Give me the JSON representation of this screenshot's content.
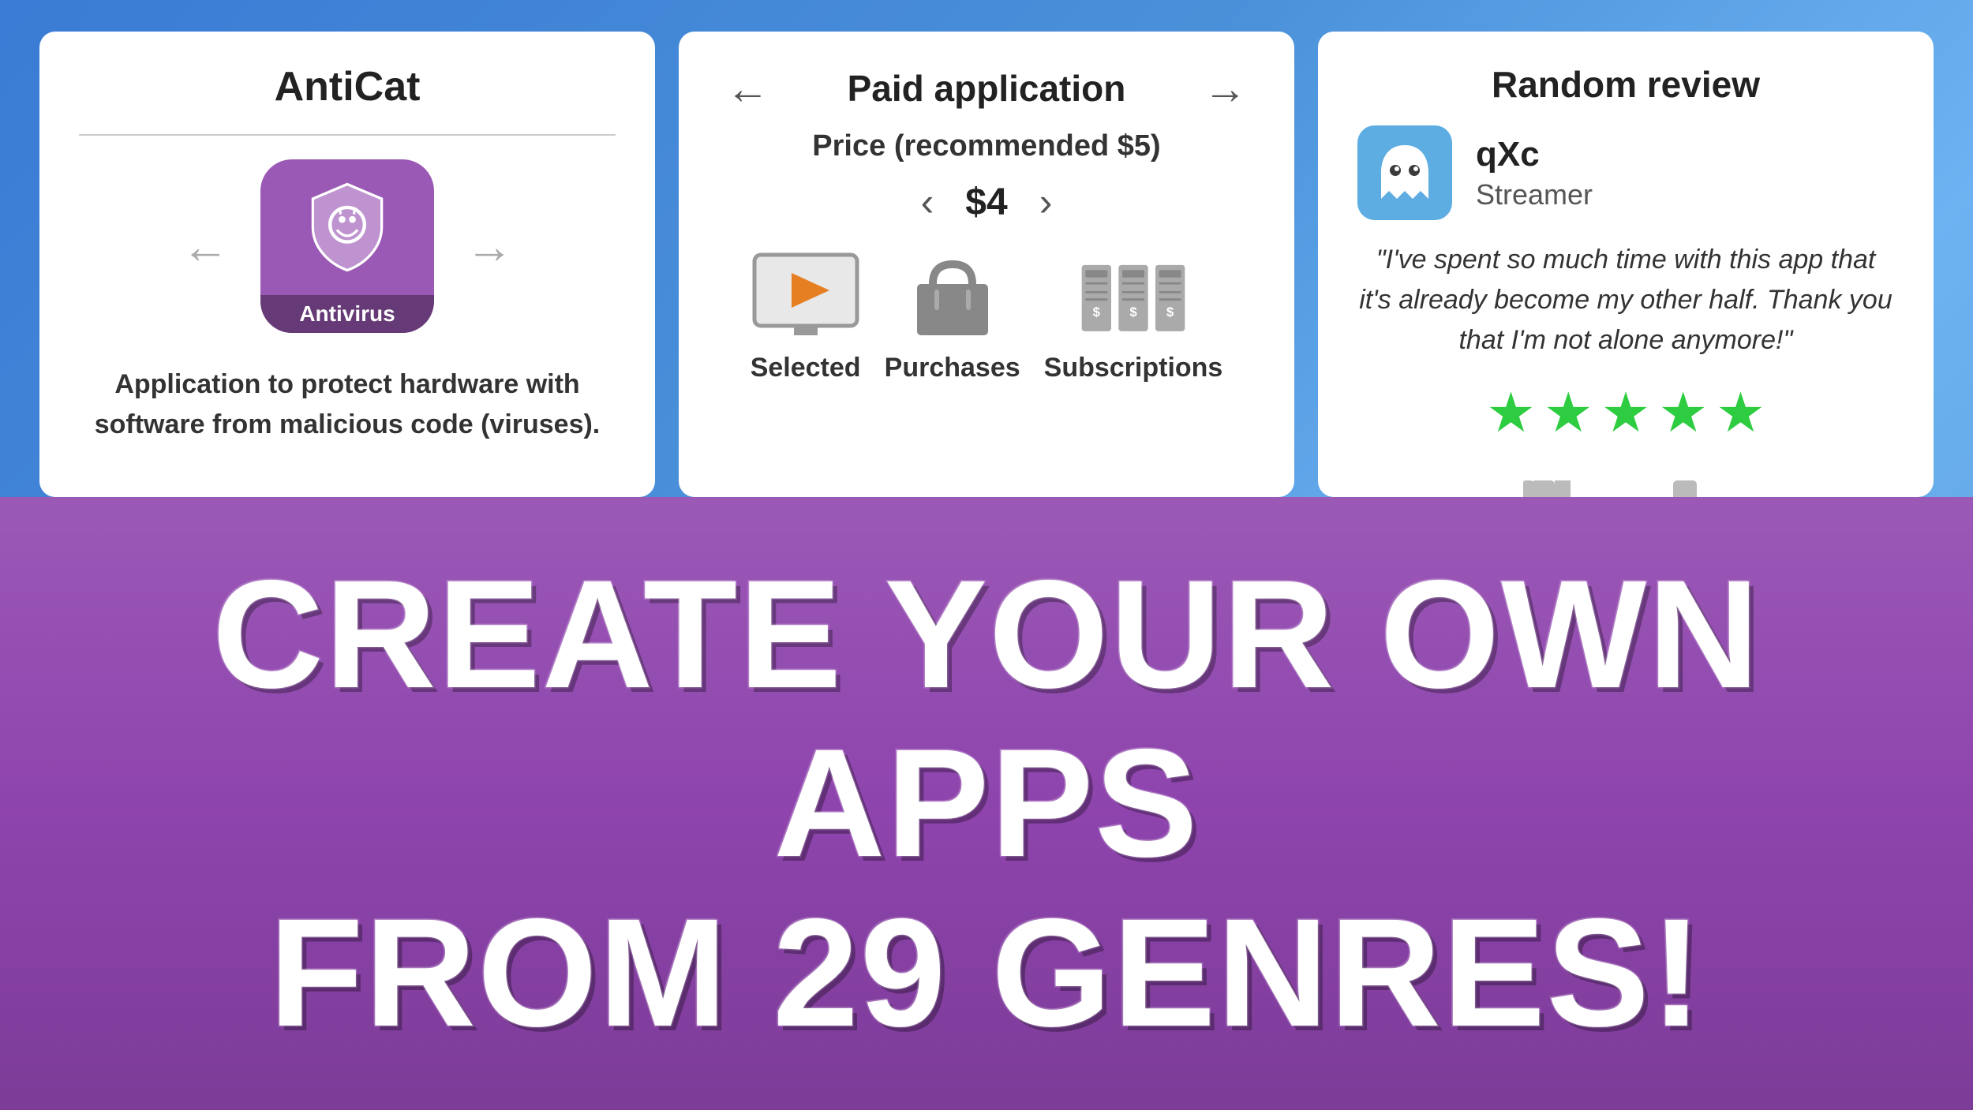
{
  "card1": {
    "title": "AntiCat",
    "app_label": "Antivirus",
    "description": "Application to protect hardware with software from malicious code (viruses).",
    "nav_left": "←",
    "nav_right": "→"
  },
  "card2": {
    "title": "Paid application",
    "price_label": "Price (recommended $5)",
    "price": "$4",
    "nav_left": "←",
    "nav_right": "→",
    "price_left": "‹",
    "price_right": "›",
    "options": [
      {
        "label": "Selected"
      },
      {
        "label": "Purchases"
      },
      {
        "label": "Subscriptions"
      }
    ]
  },
  "card3": {
    "title": "Random review",
    "reviewer_name": "qXc",
    "reviewer_role": "Streamer",
    "review_text": "\"I've spent so much time with this app that it's already become my other half. Thank you that I'm not alone anymore!\"",
    "stars_count": 5,
    "stars_color": "#2ecc40"
  },
  "banner": {
    "line1": "CREATE YOUR OWN APPS",
    "line2": "FROM 29 GENRES!"
  }
}
